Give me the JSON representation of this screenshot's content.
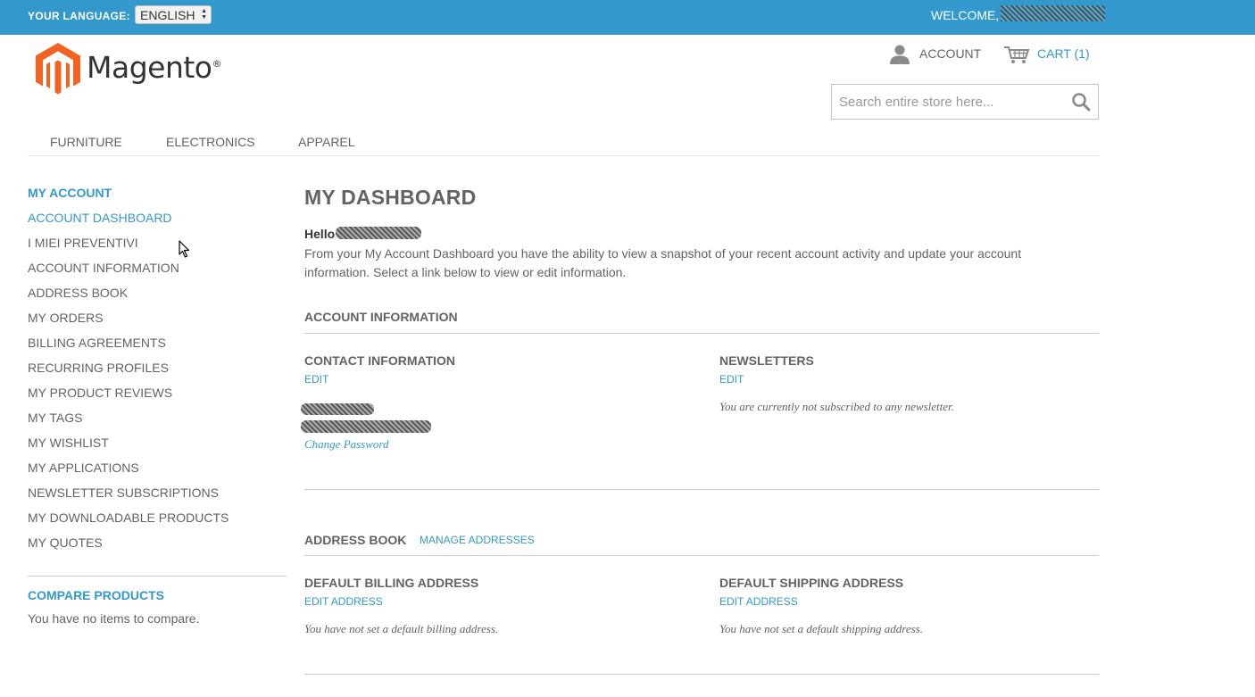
{
  "topbar": {
    "language_label": "YOUR LANGUAGE:",
    "language_selected": "ENGLISH",
    "welcome": "WELCOME,"
  },
  "header": {
    "logo_text": "Magento",
    "logo_reg": "®",
    "account_label": "ACCOUNT",
    "cart_label": "CART (1)",
    "search_placeholder": "Search entire store here..."
  },
  "nav": {
    "items": [
      "FURNITURE",
      "ELECTRONICS",
      "APPAREL"
    ]
  },
  "sidebar": {
    "title": "MY ACCOUNT",
    "items": [
      "ACCOUNT DASHBOARD",
      "I MIEI PREVENTIVI",
      "ACCOUNT INFORMATION",
      "ADDRESS BOOK",
      "MY ORDERS",
      "BILLING AGREEMENTS",
      "RECURRING PROFILES",
      "MY PRODUCT REVIEWS",
      "MY TAGS",
      "MY WISHLIST",
      "MY APPLICATIONS",
      "NEWSLETTER SUBSCRIPTIONS",
      "MY DOWNLOADABLE PRODUCTS",
      "MY QUOTES"
    ],
    "active_index": 0,
    "compare_title": "COMPARE PRODUCTS",
    "compare_text": "You have no items to compare."
  },
  "main": {
    "title": "MY DASHBOARD",
    "hello": "Hello",
    "intro": "From your My Account Dashboard you have the ability to view a snapshot of your recent account activity and update your account information. Select a link below to view or edit information.",
    "account_info": {
      "title": "ACCOUNT INFORMATION",
      "contact_title": "CONTACT INFORMATION",
      "contact_edit": "EDIT",
      "change_password": "Change Password",
      "newsletters_title": "NEWSLETTERS",
      "newsletters_edit": "EDIT",
      "newsletters_note": "You are currently not subscribed to any newsletter."
    },
    "address_book": {
      "title": "ADDRESS BOOK",
      "manage": "MANAGE ADDRESSES",
      "billing_title": "DEFAULT BILLING ADDRESS",
      "billing_edit": "EDIT ADDRESS",
      "billing_note": "You have not set a default billing address.",
      "shipping_title": "DEFAULT SHIPPING ADDRESS",
      "shipping_edit": "EDIT ADDRESS",
      "shipping_note": "You have not set a default shipping address."
    }
  },
  "colors": {
    "accent": "#3399cc",
    "logo_orange": "#f26322",
    "text": "#636363"
  }
}
